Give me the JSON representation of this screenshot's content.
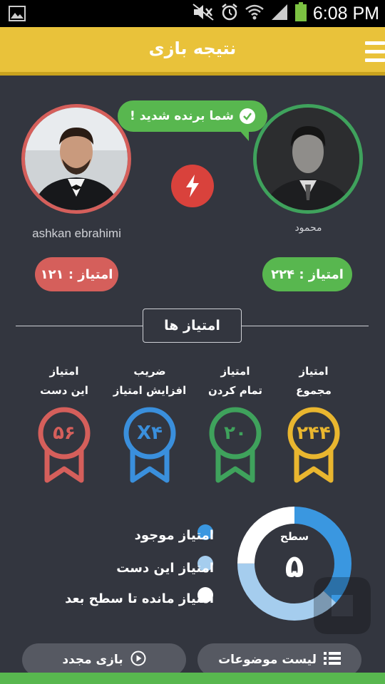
{
  "status_bar": {
    "time": "6:08 PM",
    "icons": [
      "image-icon",
      "mute-icon",
      "alarm-icon",
      "wifi-icon",
      "signal-icon",
      "battery-icon"
    ]
  },
  "header": {
    "title": "نتیجه بازی",
    "menu_icon": "menu-icon",
    "color": "#e9c23a"
  },
  "players": {
    "left": {
      "name": "ashkan ebrahimi",
      "score_label": "امتیاز : ۱۲۱",
      "color": "#d55f5b"
    },
    "right": {
      "name": "محمود",
      "score_label": "امتیاز : ۲۲۴",
      "color": "#58b74f"
    },
    "winner_text": "شما برنده شدید !",
    "vs_icon": "lightning-icon"
  },
  "scores_section": {
    "title": "امتیاز ها",
    "stats": [
      {
        "line1": "امتیاز",
        "line2": "مجموع",
        "value": "۲۴۴",
        "color": "#e9b62f"
      },
      {
        "line1": "امتیاز",
        "line2": "تمام کردن",
        "value": "۲۰",
        "color": "#3fa25c"
      },
      {
        "line1": "ضریب",
        "line2": "افزایش امتیاز",
        "value": "X۴",
        "color": "#3a8fdc"
      },
      {
        "line1": "امتیاز",
        "line2": "این دست",
        "value": "۵۶",
        "color": "#d55f5b"
      }
    ]
  },
  "level": {
    "label": "سطح",
    "value": "۵",
    "legend": [
      {
        "label": "امتیاز موجود",
        "color": "#3a97e0"
      },
      {
        "label": "امتیاز این دست",
        "color": "#a5cdee"
      },
      {
        "label": "امتیاز مانده تا سطح بعد",
        "color": "#ffffff"
      }
    ],
    "segments": [
      {
        "name": "امتیاز موجود",
        "fraction": 0.37,
        "color": "#3a97e0"
      },
      {
        "name": "امتیاز این دست",
        "fraction": 0.38,
        "color": "#a5cdee"
      },
      {
        "name": "امتیاز مانده تا سطح بعد",
        "fraction": 0.25,
        "color": "#ffffff"
      }
    ]
  },
  "buttons": {
    "topics": "لیست موضوعات",
    "replay": "بازی مجدد"
  }
}
